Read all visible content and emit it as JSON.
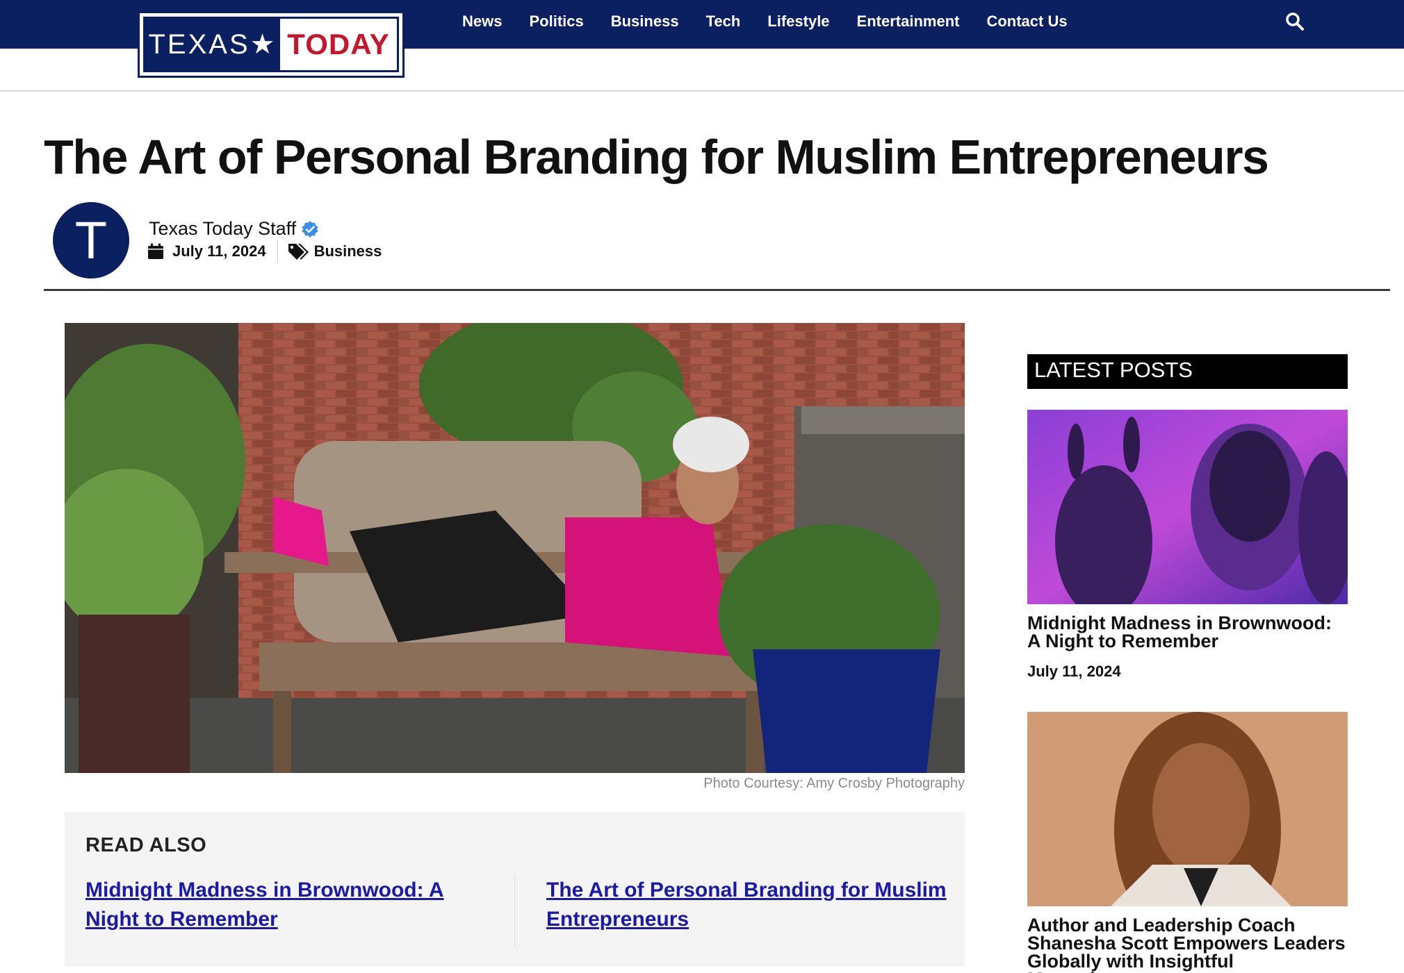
{
  "logo": {
    "part1": "TEXAS★",
    "part2": "TODAY"
  },
  "nav": {
    "items": [
      "News",
      "Politics",
      "Business",
      "Tech",
      "Lifestyle",
      "Entertainment",
      "Contact Us"
    ]
  },
  "colors": {
    "nav_bg": "#0b2060",
    "logo_red": "#c4172c",
    "link_blue": "#1a1aa6",
    "verified_blue": "#3b8ee8"
  },
  "icons": {
    "search": "search-icon",
    "verified": "verified-check-icon",
    "calendar": "calendar-icon",
    "tags": "tags-icon"
  },
  "article": {
    "title": "The Art of Personal Branding for Muslim Entrepreneurs",
    "avatar_letter": "T",
    "author": "Texas Today Staff",
    "date": "July 11, 2024",
    "category": "Business",
    "image_caption": "Photo Courtesy: Amy Crosby Photography"
  },
  "read_also": {
    "heading": "READ ALSO",
    "links": [
      "Midnight Madness in Brownwood: A Night to Remember",
      "The Art of Personal Branding for Muslim Entrepreneurs"
    ]
  },
  "sidebar": {
    "heading": "LATEST POSTS",
    "posts": [
      {
        "title": "Midnight Madness in Brownwood: A Night to Remember",
        "date": "July 11, 2024"
      },
      {
        "title": "Author and Leadership Coach Shanesha Scott Empowers Leaders Globally with Insightful Mentoring…"
      }
    ]
  }
}
